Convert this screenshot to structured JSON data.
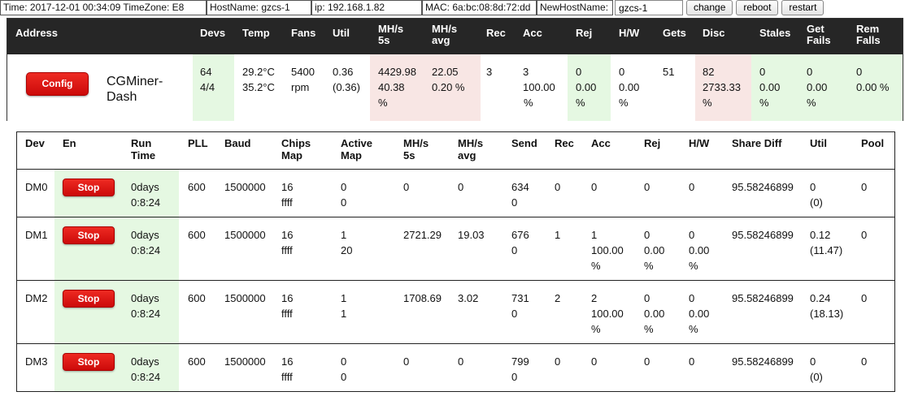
{
  "topbar": {
    "time": "Time:  2017-12-01 00:34:09 TimeZone: E8",
    "hostname": "HostName:    gzcs-1",
    "ip": "ip:     192.168.1.82",
    "mac": "MAC:     6a:bc:08:8d:72:dd",
    "new_hostname_label": "NewHostName:",
    "new_hostname_value": "gzcs-1",
    "change_label": "change",
    "reboot_label": "reboot",
    "restart_label": "restart"
  },
  "summary": {
    "headers": {
      "address": "Address",
      "devs": "Devs",
      "temp": "Temp",
      "fans": "Fans",
      "util": "Util",
      "mhs5s_1": "MH/s",
      "mhs5s_2": "5s",
      "mhsavg_1": "MH/s",
      "mhsavg_2": "avg",
      "rec": "Rec",
      "acc": "Acc",
      "rej": "Rej",
      "hw": "H/W",
      "gets": "Gets",
      "disc": "Disc",
      "stales": "Stales",
      "getfails_1": "Get",
      "getfails_2": "Fails",
      "remfails_1": "Rem",
      "remfails_2": "Falls"
    },
    "config_label": "Config",
    "name_line1": "CGMiner-",
    "name_line2": "Dash",
    "devs": [
      "64",
      "4/4"
    ],
    "temp": [
      "29.2°C",
      "35.2°C"
    ],
    "fans": [
      "5400",
      "rpm"
    ],
    "util": [
      "0.36",
      "(0.36)"
    ],
    "mhs5s": [
      "4429.98",
      "40.38",
      "%"
    ],
    "mhsavg": [
      "22.05",
      "0.20 %"
    ],
    "rec": [
      "3"
    ],
    "acc": [
      "3",
      "100.00",
      "%"
    ],
    "rej": [
      "0",
      "0.00",
      "%"
    ],
    "hw": [
      "0",
      "0.00",
      "%"
    ],
    "gets": [
      "51"
    ],
    "disc": [
      "82",
      "2733.33",
      "%"
    ],
    "stales": [
      "0",
      "0.00",
      "%"
    ],
    "getfails": [
      "0",
      "0.00",
      "%"
    ],
    "remfails": [
      "0",
      "0.00 %"
    ]
  },
  "devices": {
    "headers": {
      "dev": "Dev",
      "en": "En",
      "runtime_1": "Run",
      "runtime_2": "Time",
      "pll": "PLL",
      "baud": "Baud",
      "chips_1": "Chips",
      "chips_2": "Map",
      "active_1": "Active",
      "active_2": "Map",
      "mhs5s_1": "MH/s",
      "mhs5s_2": "5s",
      "mhsavg_1": "MH/s",
      "mhsavg_2": "avg",
      "send": "Send",
      "rec": "Rec",
      "acc": "Acc",
      "rej": "Rej",
      "hw": "H/W",
      "sharediff": "Share Diff",
      "util": "Util",
      "pool": "Pool"
    },
    "stop_label": "Stop",
    "rows": [
      {
        "dev": "DM0",
        "runtime": [
          "0days",
          "0:8:24"
        ],
        "pll": "600",
        "baud": "1500000",
        "chips": [
          "16",
          "ffff"
        ],
        "active": [
          "0",
          "0"
        ],
        "mhs5s": "0",
        "mhsavg": "0",
        "send": [
          "634",
          "0"
        ],
        "rec": "0",
        "acc": [
          "0"
        ],
        "rej": [
          "0"
        ],
        "hw": [
          "0"
        ],
        "sharediff": "95.58246899",
        "util": [
          "0",
          "(0)"
        ],
        "pool": "0"
      },
      {
        "dev": "DM1",
        "runtime": [
          "0days",
          "0:8:24"
        ],
        "pll": "600",
        "baud": "1500000",
        "chips": [
          "16",
          "ffff"
        ],
        "active": [
          "1",
          "20"
        ],
        "mhs5s": "2721.29",
        "mhsavg": "19.03",
        "send": [
          "676",
          "0"
        ],
        "rec": "1",
        "acc": [
          "1",
          "100.00",
          "%"
        ],
        "rej": [
          "0",
          "0.00",
          "%"
        ],
        "hw": [
          "0",
          "0.00",
          "%"
        ],
        "sharediff": "95.58246899",
        "util": [
          "0.12",
          "(11.47)"
        ],
        "pool": "0"
      },
      {
        "dev": "DM2",
        "runtime": [
          "0days",
          "0:8:24"
        ],
        "pll": "600",
        "baud": "1500000",
        "chips": [
          "16",
          "ffff"
        ],
        "active": [
          "1",
          "1"
        ],
        "mhs5s": "1708.69",
        "mhsavg": "3.02",
        "send": [
          "731",
          "0"
        ],
        "rec": "2",
        "acc": [
          "2",
          "100.00",
          "%"
        ],
        "rej": [
          "0",
          "0.00",
          "%"
        ],
        "hw": [
          "0",
          "0.00",
          "%"
        ],
        "sharediff": "95.58246899",
        "util": [
          "0.24",
          "(18.13)"
        ],
        "pool": "0"
      },
      {
        "dev": "DM3",
        "runtime": [
          "0days",
          "0:8:24"
        ],
        "pll": "600",
        "baud": "1500000",
        "chips": [
          "16",
          "ffff"
        ],
        "active": [
          "0",
          "0"
        ],
        "mhs5s": "0",
        "mhsavg": "0",
        "send": [
          "799",
          "0"
        ],
        "rec": "0",
        "acc": [
          "0"
        ],
        "rej": [
          "0"
        ],
        "hw": [
          "0"
        ],
        "sharediff": "95.58246899",
        "util": [
          "0",
          "(0)"
        ],
        "pool": "0"
      }
    ]
  }
}
